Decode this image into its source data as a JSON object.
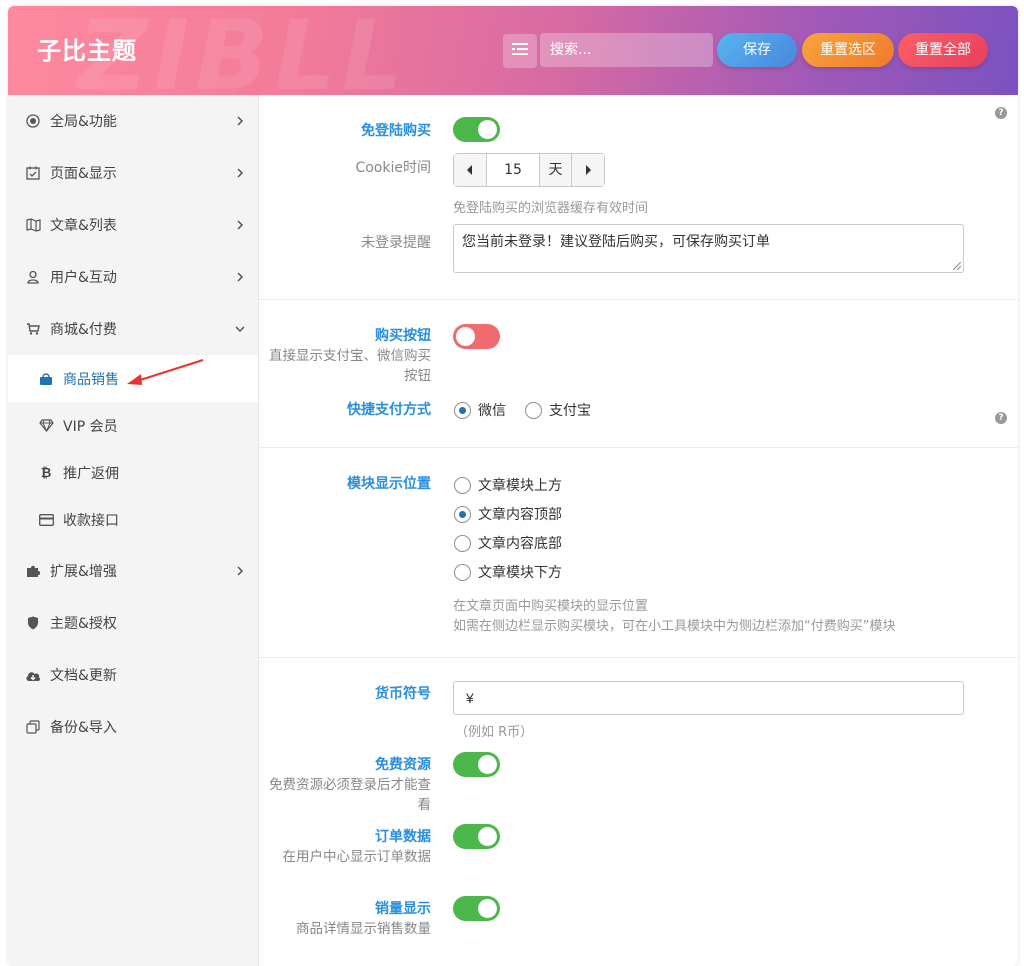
{
  "header": {
    "title": "子比主题",
    "watermark": "ZIBLL",
    "search_placeholder": "搜索...",
    "save": "保存",
    "reset_section": "重置选区",
    "reset_all": "重置全部"
  },
  "sidebar": {
    "items": [
      {
        "label": "全局&功能",
        "icon": "target-icon"
      },
      {
        "label": "页面&显示",
        "icon": "calendar-check-icon"
      },
      {
        "label": "文章&列表",
        "icon": "map-icon"
      },
      {
        "label": "用户&互动",
        "icon": "user-icon"
      },
      {
        "label": "商城&付费",
        "icon": "cart-icon"
      },
      {
        "label": "扩展&增强",
        "icon": "puzzle-icon"
      },
      {
        "label": "主题&授权",
        "icon": "shield-icon"
      },
      {
        "label": "文档&更新",
        "icon": "cloud-download-icon"
      },
      {
        "label": "备份&导入",
        "icon": "copy-icon"
      }
    ],
    "subitems": [
      {
        "label": "商品销售",
        "icon": "shopping-bag-icon"
      },
      {
        "label": "VIP 会员",
        "icon": "diamond-icon"
      },
      {
        "label": "推广返佣",
        "icon": "bitcoin-icon"
      },
      {
        "label": "收款接口",
        "icon": "credit-card-icon"
      }
    ]
  },
  "section1": {
    "free_buy_label": "免登陆购买",
    "free_buy_on": true,
    "cookie_label": "Cookie时间",
    "cookie_value": "15",
    "cookie_unit": "天",
    "cookie_help": "免登陆购买的浏览器缓存有效时间",
    "notice_label": "未登录提醒",
    "notice_value": "您当前未登录！建议登陆后购买，可保存购买订单"
  },
  "section2": {
    "buy_button_label": "购买按钮",
    "buy_button_desc": "直接显示支付宝、微信购买按钮",
    "buy_button_on": false,
    "quick_pay_label": "快捷支付方式",
    "quick_pay_options": [
      "微信",
      "支付宝"
    ],
    "quick_pay_selected": "微信"
  },
  "section3": {
    "position_label": "模块显示位置",
    "position_options": [
      "文章模块上方",
      "文章内容顶部",
      "文章内容底部",
      "文章模块下方"
    ],
    "position_selected": "文章内容顶部",
    "position_help_1": "在文章页面中购买模块的显示位置",
    "position_help_2": "如需在侧边栏显示购买模块，可在小工具模块中为侧边栏添加“付费购买”模块"
  },
  "section4": {
    "currency_label": "货币符号",
    "currency_value": "¥",
    "currency_help": "（例如 R币）",
    "free_res_label": "免费资源",
    "free_res_desc": "免费资源必须登录后才能查看",
    "free_res_on": true,
    "order_label": "订单数据",
    "order_desc": "在用户中心显示订单数据",
    "order_on": true,
    "sales_label": "销量显示",
    "sales_desc": "商品详情显示销售数量",
    "sales_on": true
  },
  "colors": {
    "accent_blue": "#2a8fe0",
    "toggle_on": "#4cb74a",
    "toggle_off": "#f06b6e",
    "active_nav": "#2271b1"
  }
}
